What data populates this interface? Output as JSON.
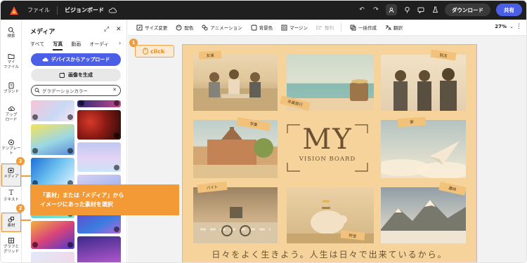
{
  "topbar": {
    "menu_file": "ファイル",
    "doc_title": "ビジョンボード",
    "download_label": "ダウンロード",
    "share_label": "共有"
  },
  "rail": {
    "items": [
      {
        "label": "検索"
      },
      {
        "label": "マイ\nファイル"
      },
      {
        "label": "ブランド"
      },
      {
        "label": "アップ\nロード"
      },
      {
        "label": "テンプレー\nト"
      },
      {
        "label": "メディア"
      },
      {
        "label": "テキスト"
      },
      {
        "label": "素材"
      },
      {
        "label": "グラフと\nグリッド"
      }
    ]
  },
  "panel": {
    "title": "メディア",
    "tabs": [
      "すべて",
      "写真",
      "動画",
      "オーディ"
    ],
    "upload_label": "デバイスからアップロード",
    "generate_label": "画像を生成",
    "search_value": "グラデーションカラー"
  },
  "toolbar": {
    "items": [
      "サイズ変更",
      "配色",
      "アニメーション",
      "背景色",
      "マージン",
      "整列",
      "一括作成",
      "翻訳"
    ],
    "zoom": "27%"
  },
  "board": {
    "tapes": [
      "友達",
      "卒業旅行",
      "就活",
      "学業",
      "夢",
      "バイト",
      "貯金",
      "趣味"
    ],
    "title": "MY",
    "subtitle": "VISION BOARD",
    "quote": "日々をよく生きよう。人生は日々で出来ているから。"
  },
  "annotations": {
    "click_label": "click",
    "step1": "1",
    "step2": "2",
    "callout_line1": "「素材」または「メディア」から",
    "callout_line2": "イメージにあった素材を選択"
  },
  "colors": {
    "accent": "#4b5fe6",
    "annotation": "#f39a36",
    "board_bg": "#f5d8a8"
  }
}
